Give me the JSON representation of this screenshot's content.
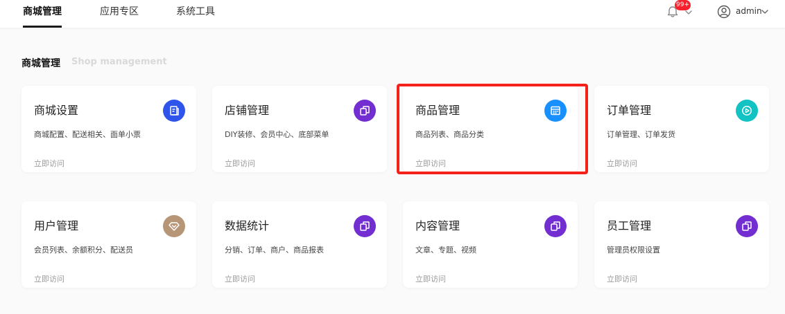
{
  "header": {
    "tabs": [
      {
        "label": "商城管理",
        "active": true
      },
      {
        "label": "应用专区",
        "active": false
      },
      {
        "label": "系统工具",
        "active": false
      }
    ],
    "notification_badge": "99+",
    "username": "admin"
  },
  "section": {
    "title": "商城管理",
    "subtitle": "Shop management"
  },
  "cards": [
    {
      "title": "商城设置",
      "desc": "商城配置、配送相关、面单小票",
      "link": "立即访问",
      "icon": "document-icon",
      "icon_color": "#2f54eb"
    },
    {
      "title": "店铺管理",
      "desc": "DIY装修、会员中心、底部菜单",
      "link": "立即访问",
      "icon": "copy-icon",
      "icon_color": "#722ed1"
    },
    {
      "title": "商品管理",
      "desc": "商品列表、商品分类",
      "link": "立即访问",
      "icon": "calendar-icon",
      "icon_color": "#1890ff"
    },
    {
      "title": "订单管理",
      "desc": "订单管理、订单发货",
      "link": "立即访问",
      "icon": "play-icon",
      "icon_color": "#13c2c2"
    },
    {
      "title": "用户管理",
      "desc": "会员列表、余额积分、配送员",
      "link": "立即访问",
      "icon": "diamond-icon",
      "icon_color": "#b79577"
    },
    {
      "title": "数据统计",
      "desc": "分销、订单、商户、商品报表",
      "link": "立即访问",
      "icon": "copy-icon",
      "icon_color": "#722ed1"
    },
    {
      "title": "内容管理",
      "desc": "文章、专题、视频",
      "link": "立即访问",
      "icon": "copy-icon",
      "icon_color": "#722ed1"
    },
    {
      "title": "员工管理",
      "desc": "管理员权限设置",
      "link": "立即访问",
      "icon": "copy-icon",
      "icon_color": "#722ed1"
    }
  ],
  "colors": {
    "highlight_border": "#f5221b",
    "badge": "#f5222d"
  }
}
